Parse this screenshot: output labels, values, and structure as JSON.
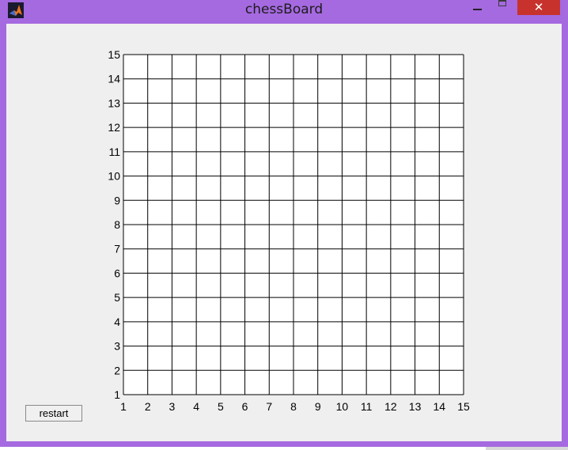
{
  "window": {
    "title": "chessBoard",
    "close_label": "✕",
    "app_icon": "matlab-logo-icon",
    "frame_color": "#a569e0",
    "client_color": "#efefef"
  },
  "board": {
    "size": 15,
    "x_ticks": [
      "1",
      "2",
      "3",
      "4",
      "5",
      "6",
      "7",
      "8",
      "9",
      "10",
      "11",
      "12",
      "13",
      "14",
      "15"
    ],
    "y_ticks": [
      "1",
      "2",
      "3",
      "4",
      "5",
      "6",
      "7",
      "8",
      "9",
      "10",
      "11",
      "12",
      "13",
      "14",
      "15"
    ],
    "xlim": [
      1,
      15
    ],
    "ylim": [
      1,
      15
    ],
    "grid": true,
    "grid_color": "#000000",
    "background": "#ffffff"
  },
  "controls": {
    "restart_label": "restart"
  }
}
